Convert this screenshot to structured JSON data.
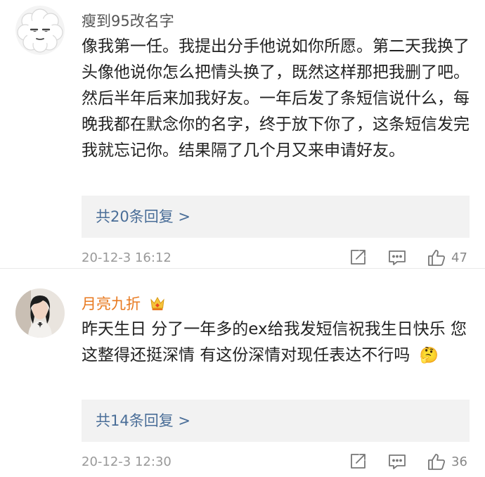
{
  "comments": [
    {
      "username": "瘦到95改名字",
      "text": "像我第一任。我提出分手他说如你所愿。第二天我换了头像他说你怎么把情头换了，既然这样那把我删了吧。然后半年后来加我好友。一年后发了条短信说什么，每晚我都在默念你的名字，终于放下你了，这条短信发完我就忘记你。结果隔了几个月又来申请好友。",
      "replies_label": "共20条回复 >",
      "timestamp": "20-12-3 16:12",
      "likes": "47",
      "name_color": "#555555",
      "avatar_icon": "cartoon-sheep-avatar"
    },
    {
      "username": "月亮九折",
      "text": "昨天生日 分了一年多的ex给我发短信祝我生日快乐 您这整得还挺深情 有这份深情对现任表达不行吗",
      "emoji": "🤔",
      "replies_label": "共14条回复 >",
      "timestamp": "20-12-3 12:30",
      "likes": "36",
      "name_color": "#e8791f",
      "avatar_icon": "person-photo-avatar",
      "badge_icon": "vip-crown-badge-icon"
    }
  ],
  "colors": {
    "link": "#4a6e98",
    "reply_bg": "#f2f2f2",
    "meta": "#999999"
  }
}
